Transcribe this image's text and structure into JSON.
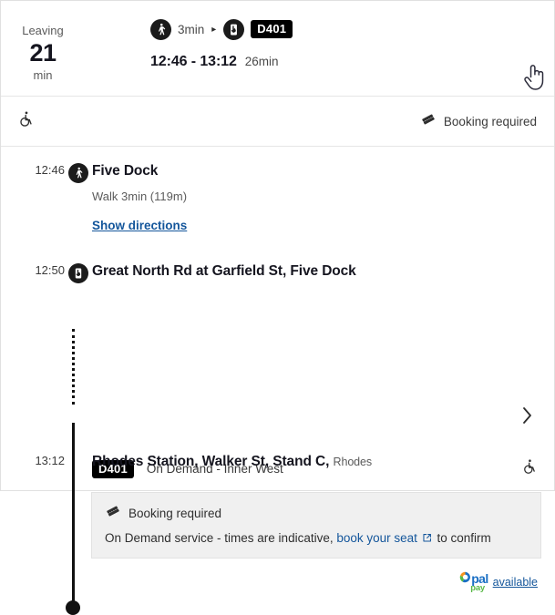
{
  "summary": {
    "leaving_label": "Leaving",
    "leaving_value": "21",
    "leaving_unit": "min",
    "walk_icon": "walking-person-icon",
    "walk_duration": "3min",
    "separator": "▸",
    "ondemand_icon": "on-demand-phone-icon",
    "route_badge": "D401",
    "time_range": "12:46 - 13:12",
    "total_duration": "26min"
  },
  "facilities": {
    "wheelchair_icon": "wheelchair-accessible-icon",
    "booking_icon": "ticket-icon",
    "booking_text": "Booking required"
  },
  "legs": [
    {
      "time": "12:46",
      "node_icon": "walking-person-icon",
      "name": "Five Dock",
      "detail": "Walk 3min (119m)",
      "link": "Show directions"
    },
    {
      "time": "12:50",
      "node_icon": "on-demand-phone-icon",
      "name": "Great North Rd at Garfield St, Five Dock",
      "chevron": "chevron-right-icon"
    },
    {
      "time": "13:12",
      "node_icon": "end-dot",
      "name": "Rhodes Station, Walker St, Stand C,",
      "suffix": "Rhodes"
    }
  ],
  "service": {
    "badge": "D401",
    "name": "On Demand - Inner West",
    "wheelchair_icon": "wheelchair-accessible-icon",
    "info": {
      "icon": "ticket-icon",
      "title": "Booking required",
      "desc_before": "On Demand service - times are indicative,",
      "link": "book your seat",
      "desc_after": "to confirm"
    }
  },
  "opal": {
    "logo_o": "o",
    "logo_pal": "pal",
    "logo_pay": "pay",
    "available_text": "available"
  },
  "colors": {
    "accent_link": "#14569b",
    "badge_bg": "#000000",
    "info_bg": "#f0f0f0",
    "opal_blue": "#1a6fc4",
    "opal_green": "#58b947",
    "opal_orange": "#f7941d"
  },
  "cursor": {
    "type": "pointing-hand-cursor"
  }
}
